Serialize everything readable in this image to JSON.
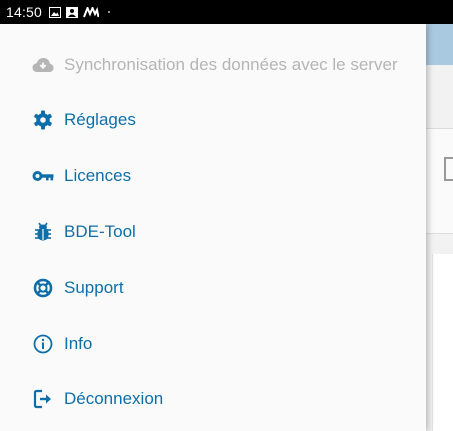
{
  "status_bar": {
    "time": "14:50",
    "icons": [
      "image-icon",
      "photo-icon",
      "app-logo-icon",
      "dot-icon"
    ]
  },
  "drawer": {
    "accent_color": "#0e6fa8",
    "disabled_color": "#b5b5b5",
    "items": [
      {
        "label": "Synchronisation des données avec le server",
        "icon": "cloud-download-icon",
        "enabled": false
      },
      {
        "label": "Réglages",
        "icon": "gear-icon",
        "enabled": true
      },
      {
        "label": "Licences",
        "icon": "key-icon",
        "enabled": true
      },
      {
        "label": "BDE-Tool",
        "icon": "bug-icon",
        "enabled": true
      },
      {
        "label": "Support",
        "icon": "lifebuoy-icon",
        "enabled": true
      },
      {
        "label": "Info",
        "icon": "info-icon",
        "enabled": true
      },
      {
        "label": "Déconnexion",
        "icon": "logout-icon",
        "enabled": true
      }
    ]
  }
}
